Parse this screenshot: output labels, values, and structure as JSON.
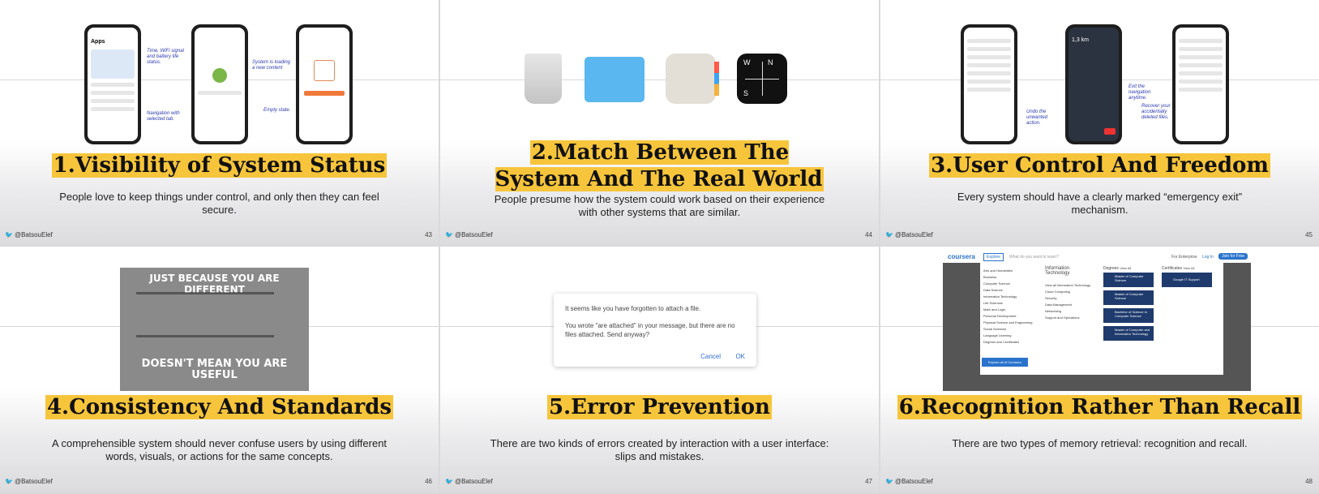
{
  "footer": {
    "handle": "@BatsouElef"
  },
  "slides": [
    {
      "title": "1.Visibility of System Status",
      "desc": "People love to keep things under control, and only then they can feel secure.",
      "page": "43",
      "illustration": {
        "phone1_title": "Apps",
        "notes": [
          "Time, WiFi signal and battery life status.",
          "System is loading a new content",
          "Empty state.",
          "Navigation with selected tab."
        ]
      }
    },
    {
      "title": "2.Match Between The System And The Real World",
      "desc": "People presume how the system could work based on their experience with other systems that are similar.",
      "page": "44",
      "icons": [
        "trash-icon",
        "folder-icon",
        "contacts-icon",
        "compass-icon"
      ],
      "compass": {
        "n": "N",
        "s": "S",
        "w": "W"
      }
    },
    {
      "title": "3.User Control And Freedom",
      "desc": "Every system should have a clearly marked “emergency exit” mechanism.",
      "page": "45",
      "illustration": {
        "distance": "1,3 km",
        "notes": [
          "Undo the unwanted action.",
          "Exit the navigation anytime.",
          "Recover your accidentally deleted files."
        ]
      }
    },
    {
      "title": "4.Consistency And Standards",
      "desc": "A comprehensible system should never confuse users by using different words, visuals, or actions for the same concepts.",
      "page": "46",
      "meme": {
        "top": "JUST BECAUSE YOU ARE DIFFERENT",
        "bottom": "DOESN'T MEAN YOU ARE USEFUL"
      }
    },
    {
      "title": "5.Error Prevention",
      "desc": "There are two kinds of errors created by interaction with a user interface: slips and mistakes.",
      "page": "47",
      "dialog": {
        "line1": "It seems like you have forgotten to attach a file.",
        "line2": "You wrote \"are attached\" in your message, but there are no files attached. Send anyway?",
        "cancel": "Cancel",
        "ok": "OK"
      }
    },
    {
      "title": "6.Recognition Rather Than Recall",
      "desc": "There are two types of memory retrieval: recognition and recall.",
      "page": "48",
      "coursera": {
        "logo": "coursera",
        "explore": "Explore",
        "search": "What do you want to learn?",
        "enterprise": "For Enterprise",
        "login": "Log In",
        "join": "Join for Free",
        "menu": [
          "Arts and Humanities",
          "Business",
          "Computer Science",
          "Data Science",
          "Information Technology",
          "Life Sciences",
          "Math and Logic",
          "Personal Development",
          "Physical Science and Engineering",
          "Social Sciences",
          "Language Learning",
          "Degrees and Certificates"
        ],
        "sub_title": "Information Technology",
        "sub_items": [
          "View all Information Technology",
          "Cloud Computing",
          "Security",
          "Data Management",
          "Networking",
          "Support and Operations"
        ],
        "degrees": "Degrees",
        "view_all": "View All",
        "certificates": "Certificates",
        "explore_all": "Explore all of Coursera",
        "degree_items": [
          "Master of Computer Science",
          "Master of Computer Science",
          "Bachelor of Science in Computer Science",
          "Master of Computer and Information Technology"
        ],
        "cert_items": [
          "Google IT Support"
        ]
      }
    }
  ]
}
